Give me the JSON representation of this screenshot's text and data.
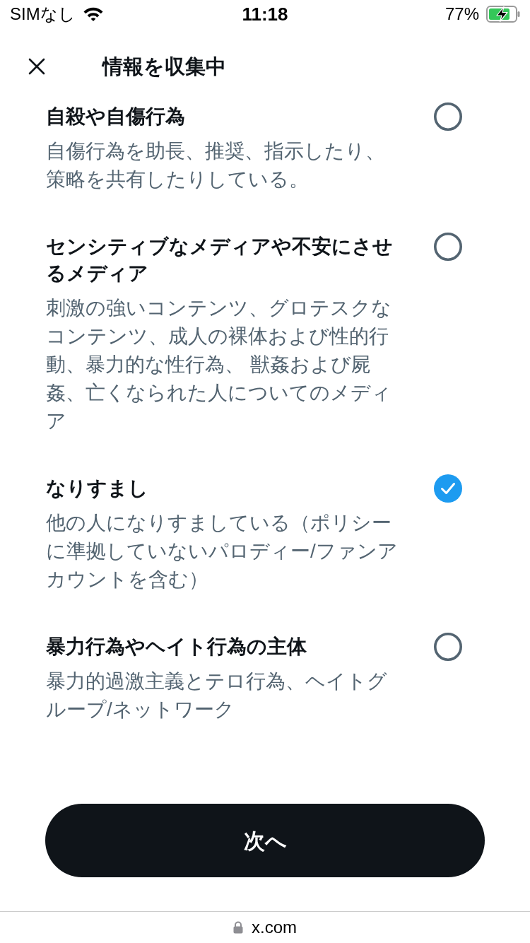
{
  "status_bar": {
    "carrier": "SIMなし",
    "time": "11:18",
    "battery": "77%"
  },
  "header": {
    "title": "情報を収集中"
  },
  "options": [
    {
      "title": "自殺や自傷行為",
      "description": "自傷行為を助長、推奨、指示したり、策略を共有したりしている。",
      "selected": false
    },
    {
      "title": "センシティブなメディアや不安にさせるメディア",
      "description": "刺激の強いコンテンツ、グロテスクなコンテンツ、成人の裸体および性的行動、暴力的な性行為、 獣姦および屍姦、亡くなられた人についてのメディア",
      "selected": false
    },
    {
      "title": "なりすまし",
      "description": "他の人になりすましている（ポリシーに準拠していないパロディー/ファンアカウントを含む）",
      "selected": true
    },
    {
      "title": "暴力行為やヘイト行為の主体",
      "description": "暴力的過激主義とテロ行為、ヘイトグループ/ネットワーク",
      "selected": false
    }
  ],
  "next_button": {
    "label": "次へ"
  },
  "browser_bar": {
    "url": "x.com"
  }
}
